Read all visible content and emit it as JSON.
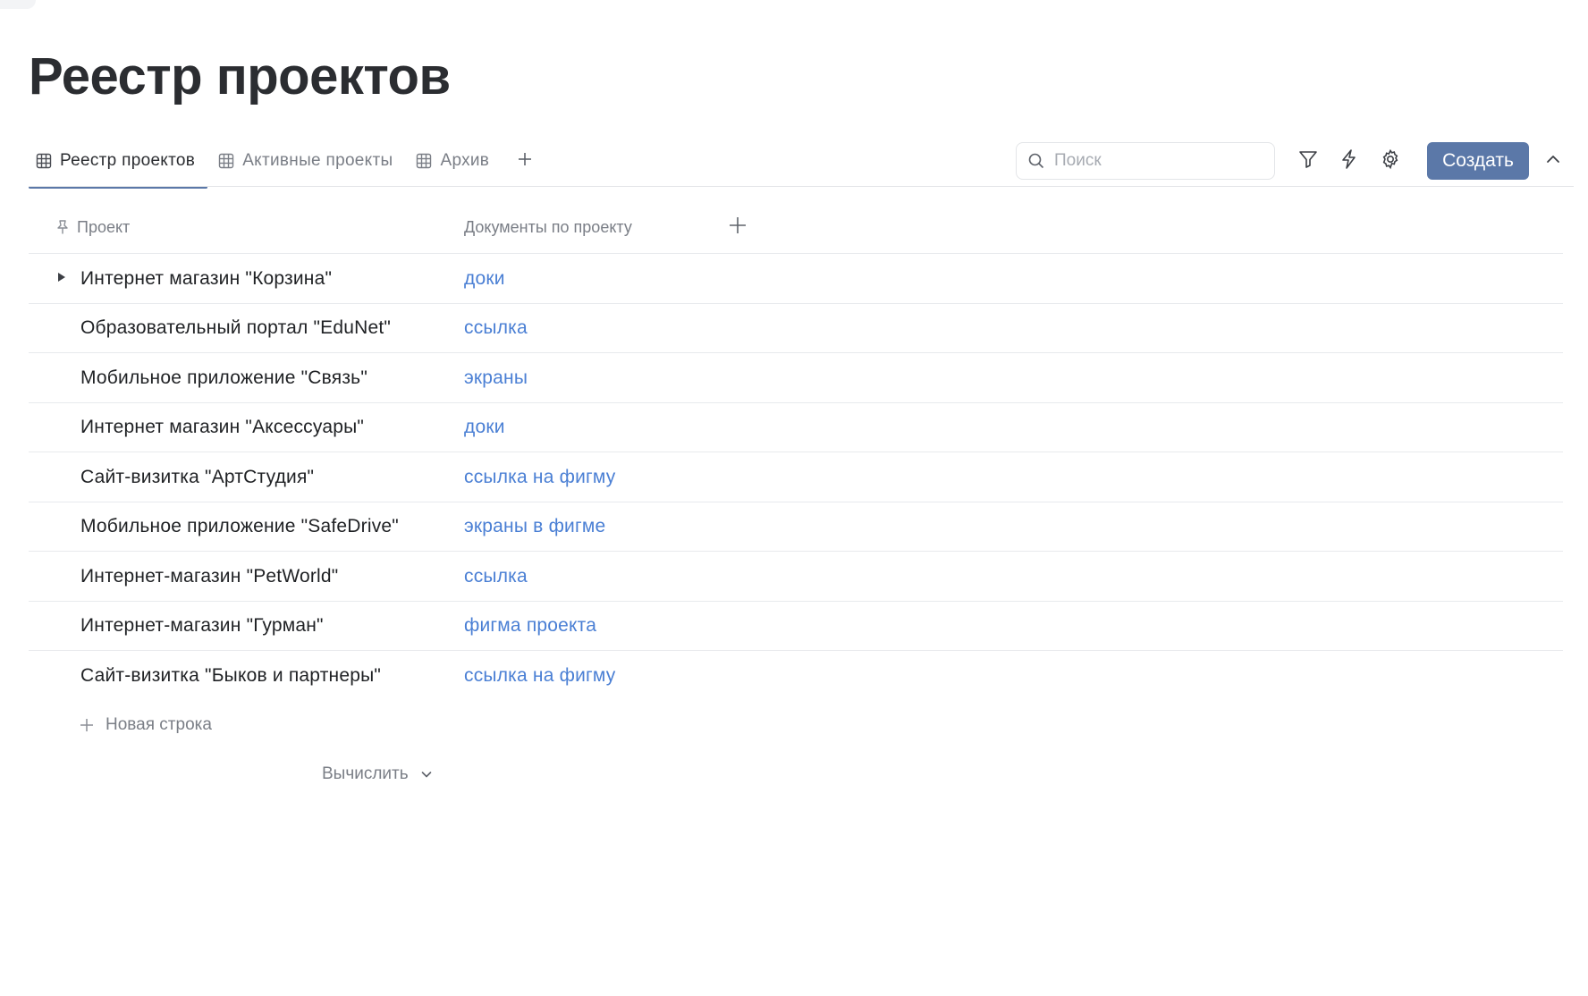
{
  "page": {
    "title": "Реестр проектов"
  },
  "tabs": [
    {
      "label": "Реестр проектов",
      "icon": "table-icon",
      "active": true
    },
    {
      "label": "Активные проекты",
      "icon": "table-icon",
      "active": false
    },
    {
      "label": "Архив",
      "icon": "table-icon",
      "active": false
    }
  ],
  "toolbar": {
    "search_placeholder": "Поиск",
    "search_value": "",
    "create_label": "Создать",
    "icons": [
      "filter-icon",
      "lightning-icon",
      "gear-icon",
      "chevron-up-icon"
    ]
  },
  "table": {
    "columns": {
      "project": "Проект",
      "docs": "Документы по проекту"
    },
    "rows": [
      {
        "project": "Интернет магазин \"Корзина\"",
        "doc": "доки",
        "expandable": true
      },
      {
        "project": "Образовательный портал \"EduNet\"",
        "doc": "ссылка",
        "expandable": false
      },
      {
        "project": "Мобильное приложение \"Связь\"",
        "doc": "экраны",
        "expandable": false
      },
      {
        "project": "Интернет магазин \"Аксессуары\"",
        "doc": "доки",
        "expandable": false
      },
      {
        "project": "Сайт-визитка \"АртСтудия\"",
        "doc": "ссылка на фигму",
        "expandable": false
      },
      {
        "project": "Мобильное приложение \"SafeDrive\"",
        "doc": "экраны в фигме",
        "expandable": false
      },
      {
        "project": "Интернет-магазин \"PetWorld\"",
        "doc": "ссылка",
        "expandable": false
      },
      {
        "project": "Интернет-магазин \"Гурман\"",
        "doc": "фигма проекта",
        "expandable": false
      },
      {
        "project": "Сайт-визитка \"Быков и партнеры\"",
        "doc": "ссылка на фигму",
        "expandable": false
      }
    ],
    "new_row_label": "Новая строка",
    "calc_label": "Вычислить"
  },
  "colors": {
    "accent": "#5b78a8",
    "link": "#4a7fd4",
    "text": "#2b2d31",
    "muted": "#7a7e86",
    "divider": "#e8eaed"
  }
}
